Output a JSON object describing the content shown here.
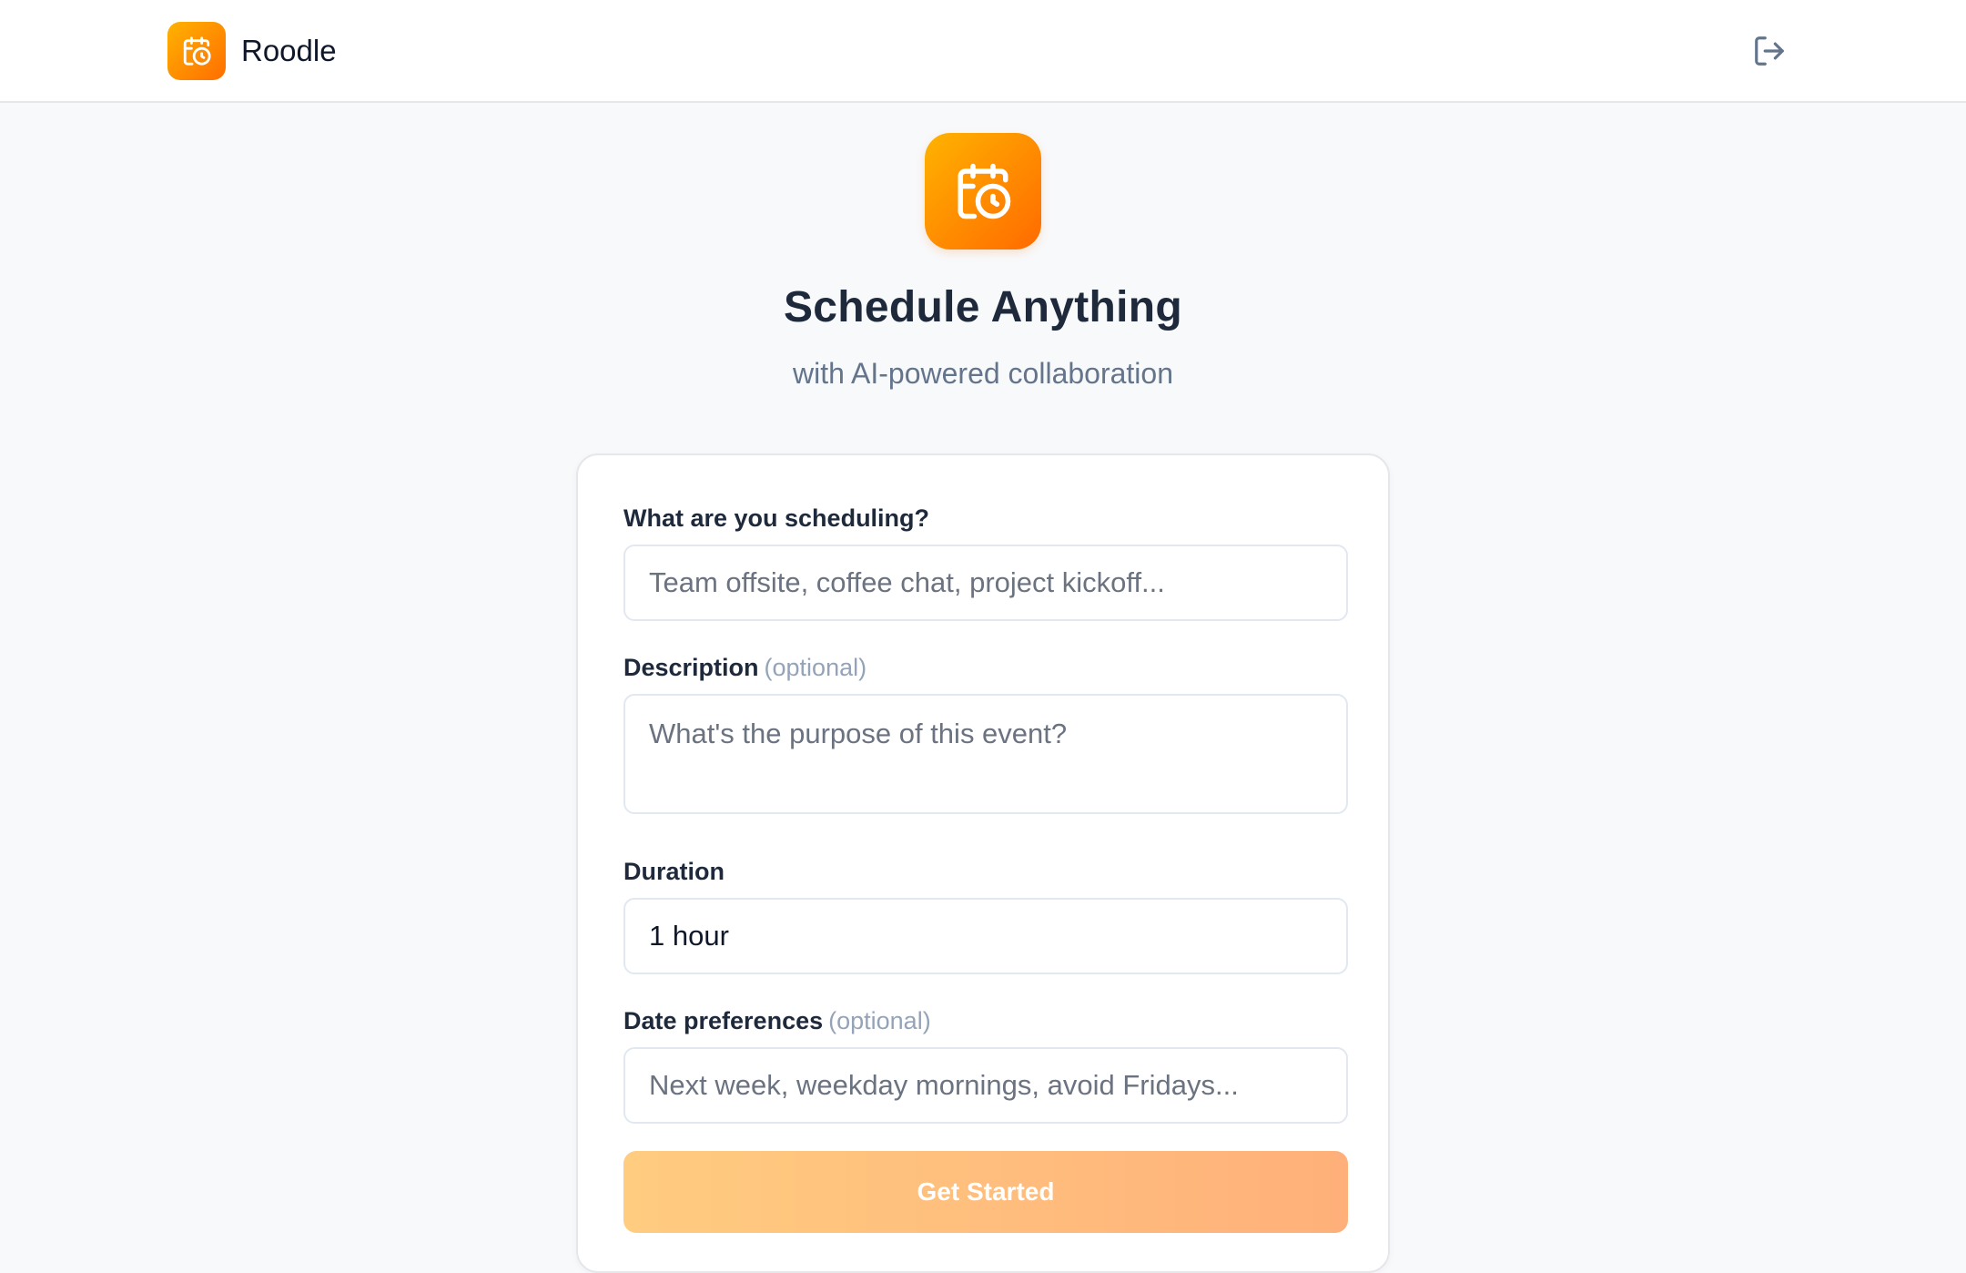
{
  "app": {
    "name": "Roodle",
    "logo_icon": "calendar-clock-icon",
    "logout_icon": "logout-icon"
  },
  "hero": {
    "icon": "calendar-clock-icon",
    "title": "Schedule Anything",
    "subtitle": "with AI-powered collaboration"
  },
  "form": {
    "title_label": "What are you scheduling?",
    "title_placeholder": "Team offsite, coffee chat, project kickoff...",
    "description_label": "Description",
    "description_optional": "(optional)",
    "description_placeholder": "What's the purpose of this event?",
    "duration_label": "Duration",
    "duration_value": "1 hour",
    "date_label": "Date preferences",
    "date_optional": "(optional)",
    "date_placeholder": "Next week, weekday mornings, avoid Fridays...",
    "submit_label": "Get Started"
  },
  "colors": {
    "accent_start": "#ffb300",
    "accent_end": "#ff6d00",
    "button_start": "#ffcc80",
    "button_end": "#ffb07a"
  }
}
